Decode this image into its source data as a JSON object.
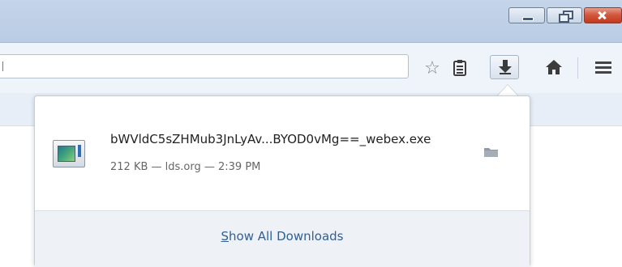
{
  "window": {
    "minimize": "minimize",
    "maximize": "restore",
    "close": "close"
  },
  "toolbar": {
    "star_icon": "star-icon",
    "reader_icon": "reading-list-icon",
    "download_icon": "download-arrow-icon",
    "home_icon": "home-icon",
    "menu_icon": "hamburger-menu-icon"
  },
  "downloads": {
    "item": {
      "filename": "bWVldC5sZHMub3JnLyAv...BYOD0vMg==_webex.exe",
      "status": "212 KB — lds.org — 2:39 PM",
      "folder_icon": "folder-icon"
    },
    "show_all_accesskey": "S",
    "show_all_rest": "how All Downloads"
  },
  "colors": {
    "link": "#2f5f96",
    "titlebar": "#c5d5e9",
    "close_button": "#c2381d"
  }
}
